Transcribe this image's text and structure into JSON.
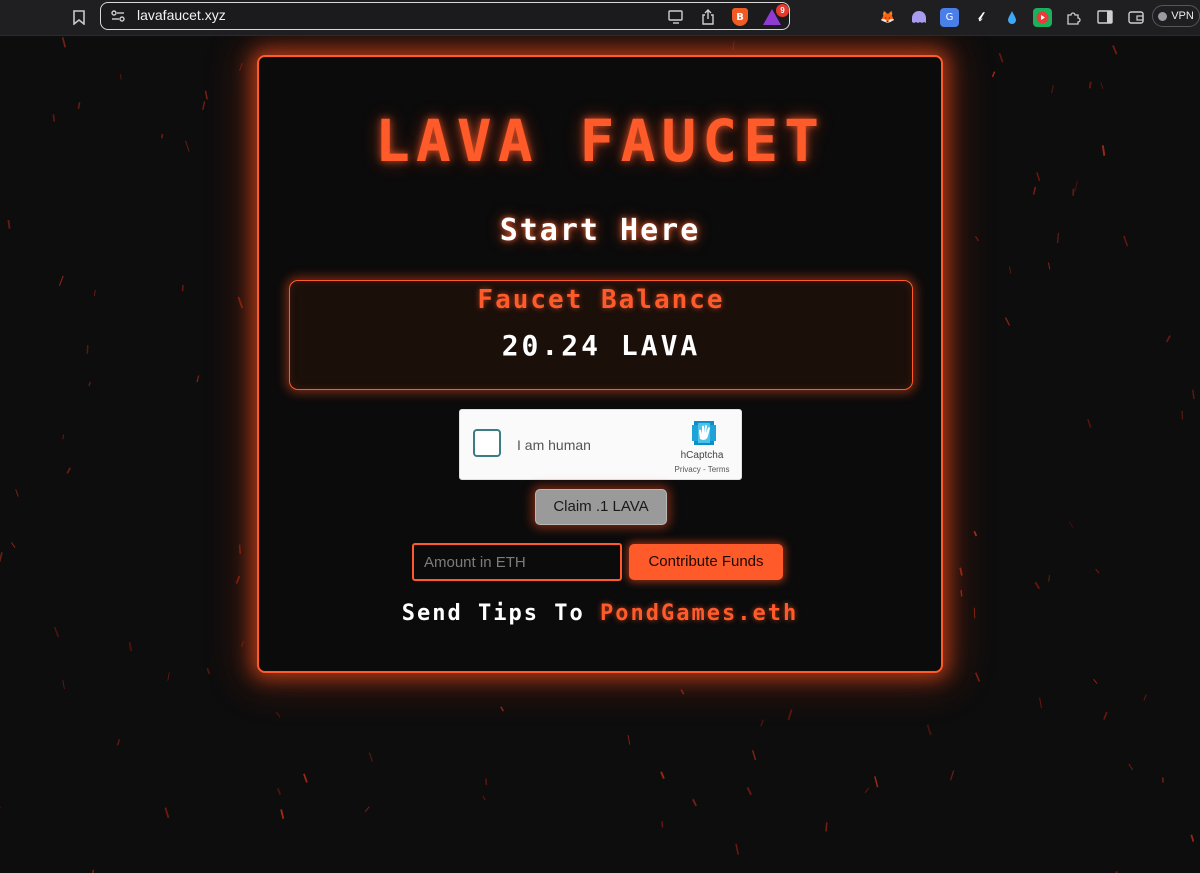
{
  "browser": {
    "url": "lavafaucet.xyz",
    "brave_shield_label": "B",
    "rewards_badge": "9",
    "vpn_label": "VPN"
  },
  "faucet": {
    "title": "LAVA FAUCET",
    "subtitle": "Start Here",
    "balance_label": "Faucet Balance",
    "balance_value": "20.24 LAVA"
  },
  "captcha": {
    "label": "I am human",
    "brand": "hCaptcha",
    "links": "Privacy - Terms"
  },
  "actions": {
    "claim_label": "Claim .1 LAVA",
    "amount_placeholder": "Amount in ETH",
    "contribute_label": "Contribute Funds"
  },
  "tips": {
    "prefix": "Send Tips To",
    "target": "PondGames.eth"
  },
  "colors": {
    "accent": "#ff5a2a",
    "background": "#0d0d0d",
    "card": "#0b0b0b"
  }
}
